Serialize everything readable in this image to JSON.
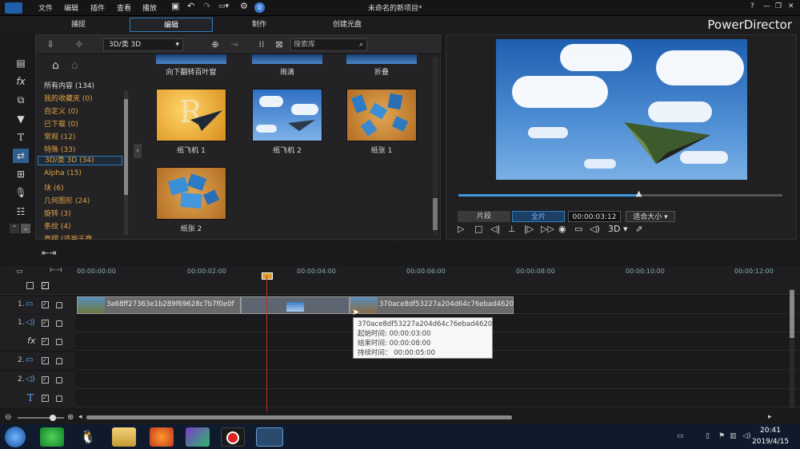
{
  "menu": {
    "file": "文件",
    "edit": "编辑",
    "plugin": "插件",
    "view": "查看",
    "play": "播放"
  },
  "window_title": "未命名的新项目*",
  "brand": "PowerDirector",
  "mode_tabs": [
    "捕捉",
    "编辑",
    "制作",
    "创建光盘"
  ],
  "library": {
    "dropdown": "3D/类 3D",
    "search_placeholder": "搜索库",
    "categories": [
      {
        "label": "所有内容 (134)",
        "selected": false
      },
      {
        "label": "我的收藏夹 (0)",
        "selected": false
      },
      {
        "label": "自定义 (0)",
        "selected": false
      },
      {
        "label": "已下载 (0)",
        "selected": false
      },
      {
        "label": "常规 (12)",
        "selected": false
      },
      {
        "label": "特殊 (33)",
        "selected": false
      },
      {
        "label": "3D/类 3D (34)",
        "selected": true
      },
      {
        "label": "Alpha (15)",
        "selected": false
      },
      {
        "label": "块 (6)",
        "selected": false
      },
      {
        "label": "几何图形 (24)",
        "selected": false
      },
      {
        "label": "旋转 (3)",
        "selected": false
      },
      {
        "label": "条纹 (4)",
        "selected": false
      },
      {
        "label": "章摺 (适用于章",
        "selected": false
      }
    ],
    "top_labels": [
      "向下翻转百叶窗",
      "雨滴",
      "折叠"
    ],
    "items": [
      {
        "label": "纸飞机 1"
      },
      {
        "label": "纸飞机 2"
      },
      {
        "label": "纸张 1"
      },
      {
        "label": "纸张 2"
      }
    ]
  },
  "preview": {
    "segment_label": "片段",
    "full_label": "全片",
    "timecode": "00:00:03:12",
    "fit_label": "适合大小",
    "mode_3d": "3D",
    "progress": 0.56
  },
  "ruler": [
    "00:00:00:00",
    "00:00:02:00",
    "00:00:04:00",
    "00:00:06:00",
    "00:00:08:00",
    "00:00:10:00",
    "00:00:12:00"
  ],
  "tracks": [
    {
      "num": "1.",
      "kind": "video"
    },
    {
      "num": "1.",
      "kind": "audio"
    },
    {
      "num": "",
      "kind": "fx"
    },
    {
      "num": "2.",
      "kind": "video"
    },
    {
      "num": "2.",
      "kind": "audio"
    },
    {
      "num": "",
      "kind": "title"
    }
  ],
  "clips": {
    "clip1": "3a68ff27363e1b289f69628c7b7f0e0f",
    "clip2": "370ace8df53227a204d64c76ebad4620"
  },
  "tooltip": {
    "name": "370ace8df53227a204d64c76ebad4620",
    "start": "起始时间: 00:00:03:00",
    "end": "结束时间: 00:00:08:00",
    "duration": "持续时间： 00:00:05:00"
  },
  "taskbar": {
    "time": "20:41",
    "date": "2019/4/15"
  }
}
